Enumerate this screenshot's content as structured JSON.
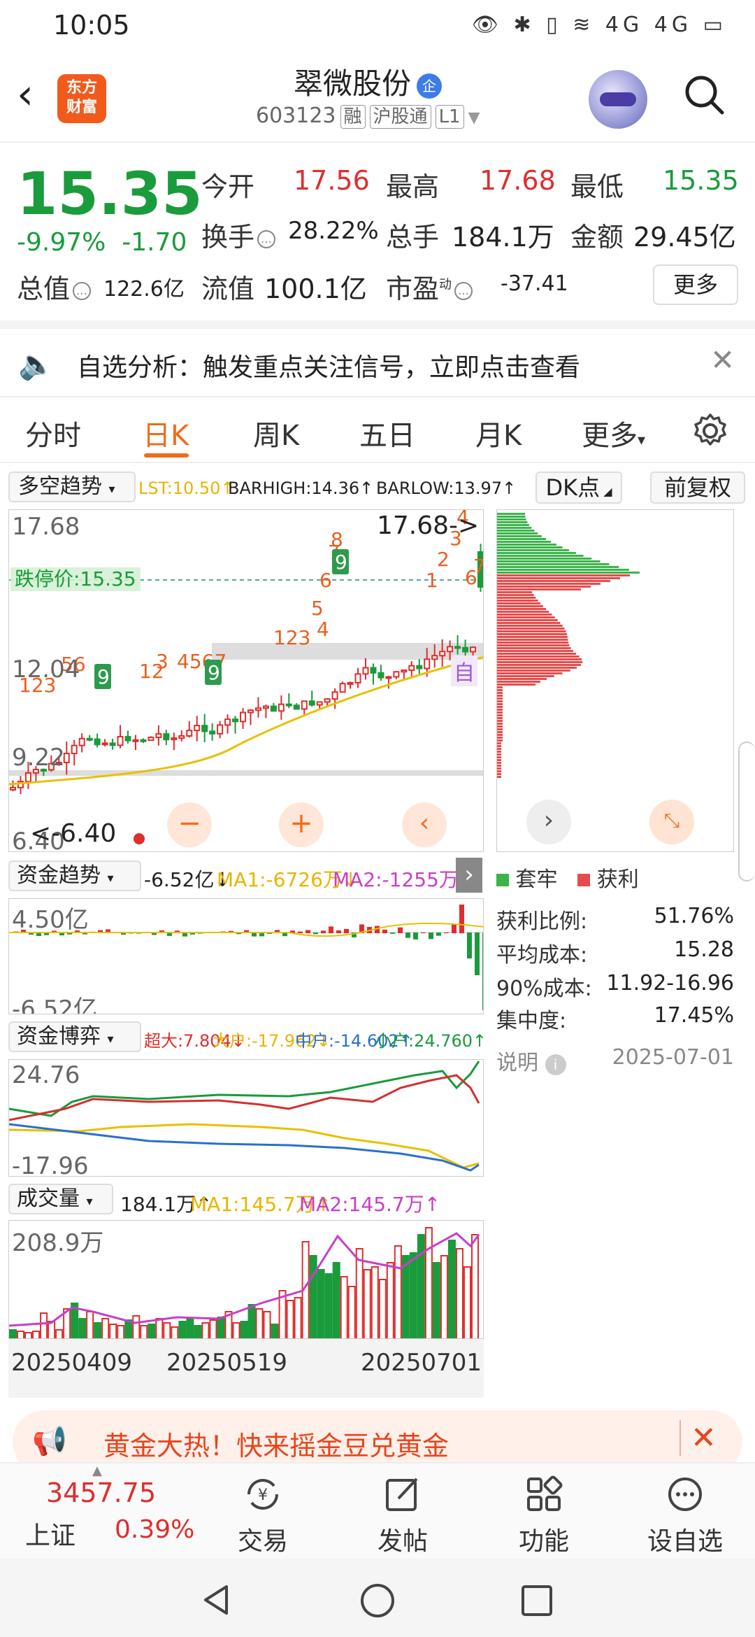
{
  "status_bar": {
    "time": "10:05",
    "icons": "👁 ✱ ▯ ≋ 4G 4G ▭"
  },
  "header": {
    "logo_line1": "东方",
    "logo_line2": "财富",
    "stock_name": "翠微股份",
    "badge": "企",
    "code": "603123",
    "tags": [
      "融",
      "沪股通",
      "L1"
    ]
  },
  "quote": {
    "price": "15.35",
    "pct": "-9.97%",
    "change": "-1.70",
    "jinkai_label": "今开",
    "jinkai": "17.56",
    "zuigao_label": "最高",
    "zuigao": "17.68",
    "zuidi_label": "最低",
    "zuidi": "15.35",
    "huanshou_label": "换手",
    "huanshou": "28.22%",
    "zongshou_label": "总手",
    "zongshou": "184.1万",
    "jine_label": "金额",
    "jine": "29.45亿",
    "zongzhi_label": "总值",
    "zongzhi": "122.6亿",
    "liuzhi_label": "流值",
    "liuzhi": "100.1亿",
    "shiying_label": "市盈",
    "shiying_sup": "动",
    "shiying": "-37.41",
    "more": "更多"
  },
  "notice": {
    "text": "自选分析：触发重点关注信号，立即点击查看"
  },
  "tabs": [
    "分时",
    "日K",
    "周K",
    "五日",
    "月K",
    "更多"
  ],
  "kline": {
    "indicator": "多空趋势",
    "lst": "LST:10.50↑",
    "barhigh": "BARHIGH:14.36↑",
    "barlow": "BARLOW:13.97↑",
    "dk_button": "DK点",
    "fq_button": "前复权",
    "y_top": "17.68",
    "y_mid": "12.04",
    "y_low": "9.22",
    "y_bottom": "6.40",
    "limit_down": "跌停价:15.35",
    "high_mark": "17.68->",
    "low_mark": "<-6.40",
    "zi": "自"
  },
  "fund_trend": {
    "name": "资金趋势",
    "value": "-6.52亿↓",
    "ma1": "MA1:-6726万↓",
    "ma2": "MA2:-1255万↓",
    "y_top": "4.50亿",
    "y_bottom": "-6.52亿"
  },
  "fund_game": {
    "name": "资金博弈",
    "super": "超大:7.804↓",
    "big": "大户:-17.962↓",
    "mid": "中户:-14.602↑",
    "small": "小户:24.760↑",
    "y_top": "24.76",
    "y_bottom": "-17.96"
  },
  "volume": {
    "name": "成交量",
    "value": "184.1万↑",
    "ma1": "MA1:145.7万↑",
    "ma2": "MA2:145.7万↑",
    "y_top": "208.9万",
    "dates": [
      "20250409",
      "20250519",
      "20250701"
    ]
  },
  "chip": {
    "legend_trapped": "套牢",
    "legend_profit": "获利",
    "rows": [
      {
        "label": "获利比例:",
        "value": "51.76%"
      },
      {
        "label": "平均成本:",
        "value": "15.28"
      },
      {
        "label": "90%成本:",
        "value": "11.92-16.96"
      },
      {
        "label": "集中度:",
        "value": "17.45%"
      }
    ],
    "explain": "说明",
    "date": "2025-07-01"
  },
  "ad": {
    "text": "黄金大热！快来摇金豆兑黄金"
  },
  "bottom_nav": {
    "index_value": "3457.75",
    "index_name": "上证",
    "index_pct": "0.39%",
    "items": [
      "交易",
      "发帖",
      "功能",
      "设自选"
    ]
  },
  "colors": {
    "up": "#e02d2d",
    "down": "#1a9b3c",
    "accent": "#f26b1d"
  }
}
